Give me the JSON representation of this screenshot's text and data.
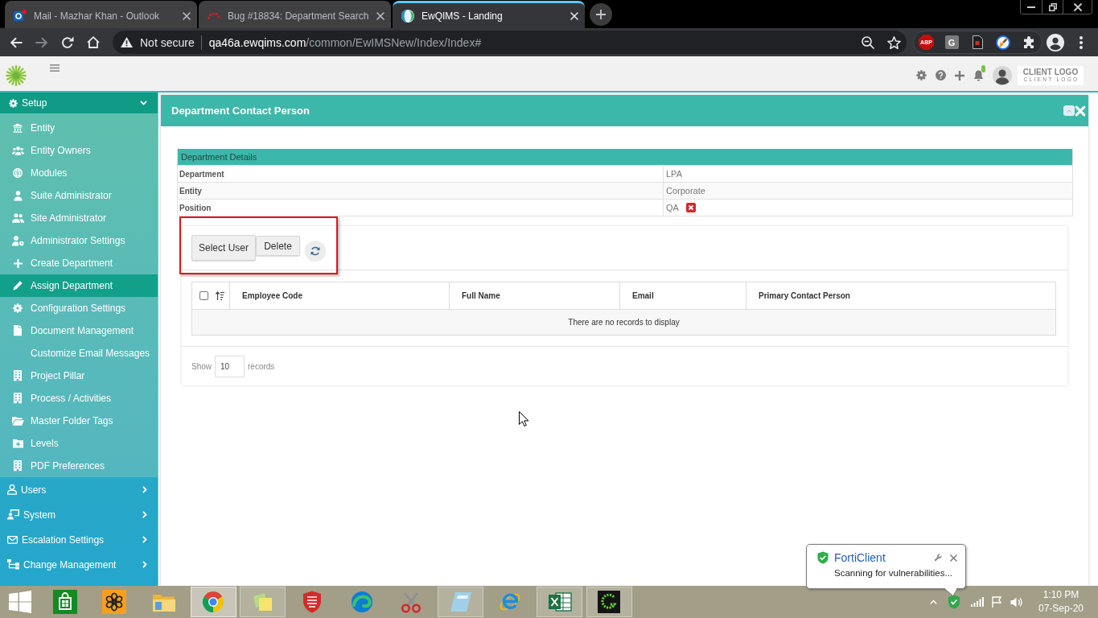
{
  "browser": {
    "tabs": [
      {
        "title": "Mail - Mazhar Khan - Outlook",
        "selected": false
      },
      {
        "title": "Bug #18834: Department Search",
        "selected": false
      },
      {
        "title": "EwQIMS - Landing",
        "selected": true
      }
    ],
    "address_bar": {
      "security_label": "Not secure",
      "host": "qa46a.ewqims.com",
      "path": "/common/EwIMSNew/Index/Index#"
    },
    "extension_badges": [
      "ABP",
      "G"
    ]
  },
  "app_header": {
    "notifications_unread": true,
    "client_logo": {
      "title": "CLIENT LOGO",
      "subtitle": "CLIENT LOGO"
    }
  },
  "sidebar": {
    "sections": [
      {
        "label": "Setup",
        "expanded": true,
        "children": [
          {
            "label": "Entity",
            "selected": false
          },
          {
            "label": "Entity Owners",
            "selected": false
          },
          {
            "label": "Modules",
            "selected": false
          },
          {
            "label": "Suite Administrator",
            "selected": false
          },
          {
            "label": "Site Administrator",
            "selected": false
          },
          {
            "label": "Administrator Settings",
            "selected": false
          },
          {
            "label": "Create Department",
            "selected": false
          },
          {
            "label": "Assign Department",
            "selected": true
          },
          {
            "label": "Configuration Settings",
            "selected": false
          },
          {
            "label": "Document Management",
            "selected": false
          },
          {
            "label": "Customize Email Messages",
            "selected": false
          },
          {
            "label": "Project Pillar",
            "selected": false
          },
          {
            "label": "Process / Activities",
            "selected": false
          },
          {
            "label": "Master Folder Tags",
            "selected": false
          },
          {
            "label": "Levels",
            "selected": false
          },
          {
            "label": "PDF Preferences",
            "selected": false
          }
        ]
      },
      {
        "label": "Users",
        "expanded": false
      },
      {
        "label": "System",
        "expanded": false
      },
      {
        "label": "Escalation Settings",
        "expanded": false
      },
      {
        "label": "Change Management",
        "expanded": false
      }
    ]
  },
  "panel": {
    "title": "Department Contact Person",
    "details": {
      "title": "Department Details",
      "rows": [
        {
          "label": "Department",
          "value": "LPA",
          "removable": false
        },
        {
          "label": "Entity",
          "value": "Corporate",
          "removable": false
        },
        {
          "label": "Position",
          "value": "QA",
          "removable": true
        }
      ]
    },
    "buttons": [
      "Select User",
      "Delete"
    ],
    "table": {
      "select_all": {
        "checked": false
      },
      "columns": [
        "Employee Code",
        "Full Name",
        "Email",
        "Primary Contact Person"
      ],
      "empty_message": "There are no records to display"
    },
    "pager": {
      "show_label": "Show",
      "page_size": "10",
      "records_label": "records"
    }
  },
  "notification": {
    "title": "FortiClient",
    "message": "Scanning for vulnerabilities..."
  },
  "taskbar": {
    "apps": [
      {
        "running": false,
        "selected": false
      },
      {
        "running": false,
        "selected": false
      },
      {
        "running": false,
        "selected": false
      },
      {
        "running": true,
        "selected": true
      },
      {
        "running": true,
        "selected": false
      },
      {
        "running": false,
        "selected": false
      },
      {
        "running": false,
        "selected": false
      },
      {
        "running": false,
        "selected": false
      },
      {
        "running": true,
        "selected": false
      },
      {
        "running": false,
        "selected": false
      },
      {
        "running": true,
        "selected": false
      },
      {
        "running": true,
        "selected": false
      }
    ],
    "clock": {
      "time": "1:10 PM",
      "date": "07-Sep-20"
    }
  }
}
